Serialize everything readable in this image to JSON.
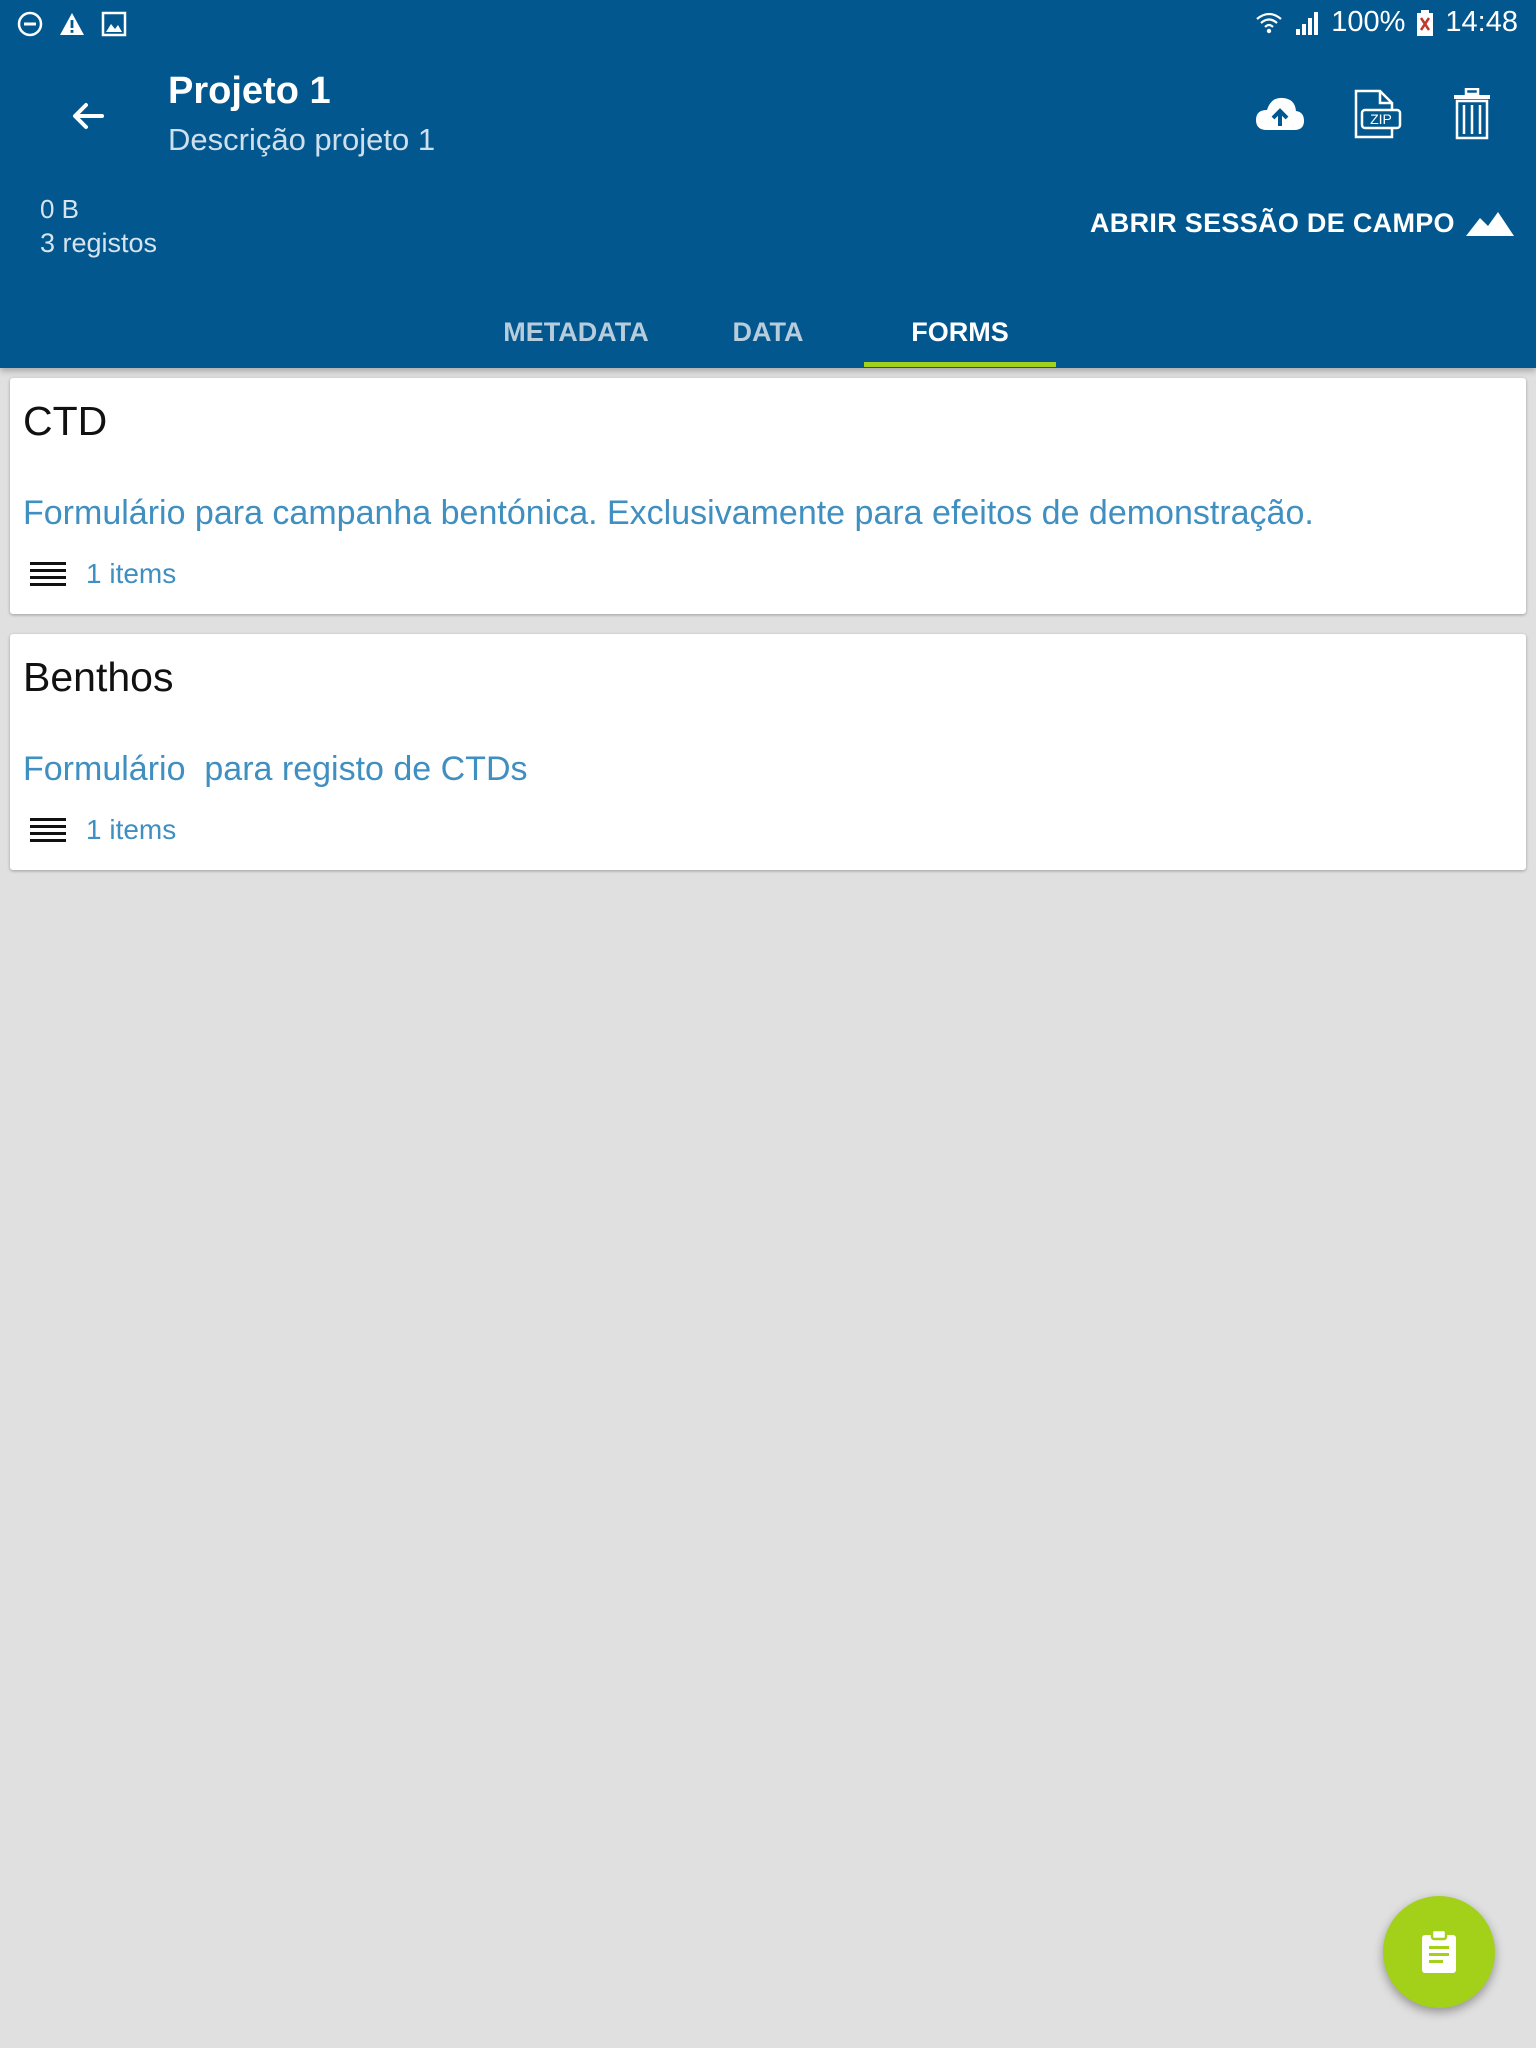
{
  "status_bar": {
    "battery": "100%",
    "time": "14:48",
    "icons": [
      "do-not-disturb-icon",
      "warning-icon",
      "image-icon",
      "wifi-icon",
      "signal-icon",
      "battery-icon"
    ]
  },
  "toolbar": {
    "title": "Projeto 1",
    "subtitle": "Descrição projeto 1",
    "back_icon": "arrow-back-icon",
    "actions": [
      "cloud-upload-icon",
      "zip-file-icon",
      "delete-icon"
    ]
  },
  "project_info": {
    "size": "0 B",
    "records": "3 registos"
  },
  "open_session": {
    "label": "ABRIR SESSÃO DE CAMPO",
    "icon": "mountain-icon"
  },
  "tabs": [
    {
      "label": "METADATA",
      "active": false
    },
    {
      "label": "DATA",
      "active": false
    },
    {
      "label": "FORMS",
      "active": true
    }
  ],
  "forms": [
    {
      "title": "CTD",
      "description": "Formulário para campanha bentónica. Exclusivamente para efeitos de demonstração.",
      "count": "1 items"
    },
    {
      "title": "Benthos",
      "description": "Formulário  para registo de CTDs",
      "count": "1 items"
    }
  ],
  "fab": {
    "icon": "clipboard-icon"
  },
  "colors": {
    "primary": "#02578f",
    "accent": "#a3d11a",
    "link_text": "#3f8fc0",
    "background": "#e0e0e0"
  }
}
